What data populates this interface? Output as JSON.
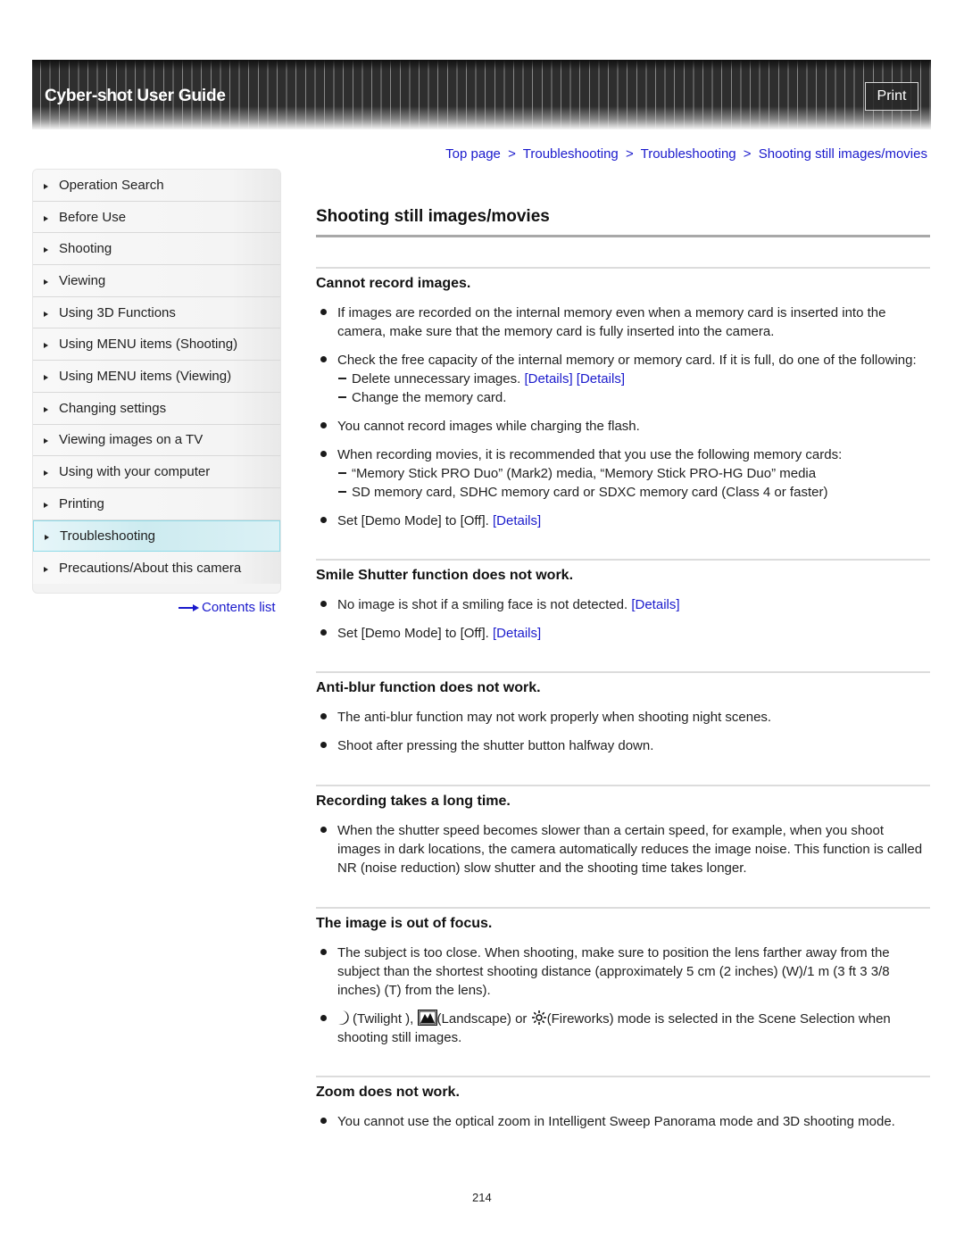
{
  "header": {
    "title": "Cyber-shot User Guide",
    "print_label": "Print"
  },
  "breadcrumb": [
    {
      "label": "Top page"
    },
    {
      "label": "Troubleshooting"
    },
    {
      "label": "Troubleshooting"
    },
    {
      "label": "Shooting still images/movies"
    }
  ],
  "breadcrumb_separator": ">",
  "sidebar": {
    "items": [
      {
        "label": "Operation Search"
      },
      {
        "label": "Before Use"
      },
      {
        "label": "Shooting"
      },
      {
        "label": "Viewing"
      },
      {
        "label": "Using 3D Functions"
      },
      {
        "label": "Using MENU items (Shooting)"
      },
      {
        "label": "Using MENU items (Viewing)"
      },
      {
        "label": "Changing settings"
      },
      {
        "label": "Viewing images on a TV"
      },
      {
        "label": "Using with your computer"
      },
      {
        "label": "Printing"
      },
      {
        "label": "Troubleshooting",
        "active": true
      },
      {
        "label": "Precautions/About this camera"
      }
    ],
    "contents_link": "Contents list"
  },
  "main": {
    "title": "Shooting still images/movies",
    "link_label": "[Details]",
    "sections": [
      {
        "heading": "Cannot record images.",
        "b1": "If images are recorded on the internal memory even when a memory card is inserted into the camera, make sure that the memory card is fully inserted into the camera.",
        "b2": "Check the free capacity of the internal memory or memory card. If it is full, do one of the following:",
        "b2_sub1": "Delete unnecessary images.",
        "b2_sub2": "Change the memory card.",
        "b3": "You cannot record images while charging the flash.",
        "b4": "When recording movies, it is recommended that you use the following memory cards:",
        "b4_sub1": "“Memory Stick PRO Duo” (Mark2) media, “Memory Stick PRO-HG Duo” media",
        "b4_sub2": "SD memory card, SDHC memory card or SDXC memory card (Class 4 or faster)",
        "b5": "Set [Demo Mode] to [Off]."
      },
      {
        "heading": "Smile Shutter function does not work.",
        "b1": "No image is shot if a smiling face is not detected.",
        "b2": "Set [Demo Mode] to [Off]."
      },
      {
        "heading": "Anti-blur function does not work.",
        "b1": "The anti-blur function may not work properly when shooting night scenes.",
        "b2": "Shoot after pressing the shutter button halfway down."
      },
      {
        "heading": "Recording takes a long time.",
        "b1": "When the shutter speed becomes slower than a certain speed, for example, when you shoot images in dark locations, the camera automatically reduces the image noise. This function is called NR (noise reduction) slow shutter and the shooting time takes longer."
      },
      {
        "heading": "The image is out of focus.",
        "b1": "The subject is too close. When shooting, make sure to position the lens farther away from the subject than the shortest shooting distance (approximately 5 cm (2 inches) (W)/1 m (3 ft 3 3/8 inches) (T) from the lens).",
        "b2_twilight": "(Twilight ),",
        "b2_landscape": "(Landscape) or",
        "b2_fireworks": "(Fireworks) mode is selected in the Scene Selection when shooting still images."
      },
      {
        "heading": "Zoom does not work.",
        "b1": "You cannot use the optical zoom in Intelligent Sweep Panorama mode and 3D shooting mode."
      }
    ]
  },
  "page_number": "214",
  "colors": {
    "link": "#1a1acc",
    "header_bg": "#2e2e2e",
    "active_item": "#cdebf0"
  }
}
